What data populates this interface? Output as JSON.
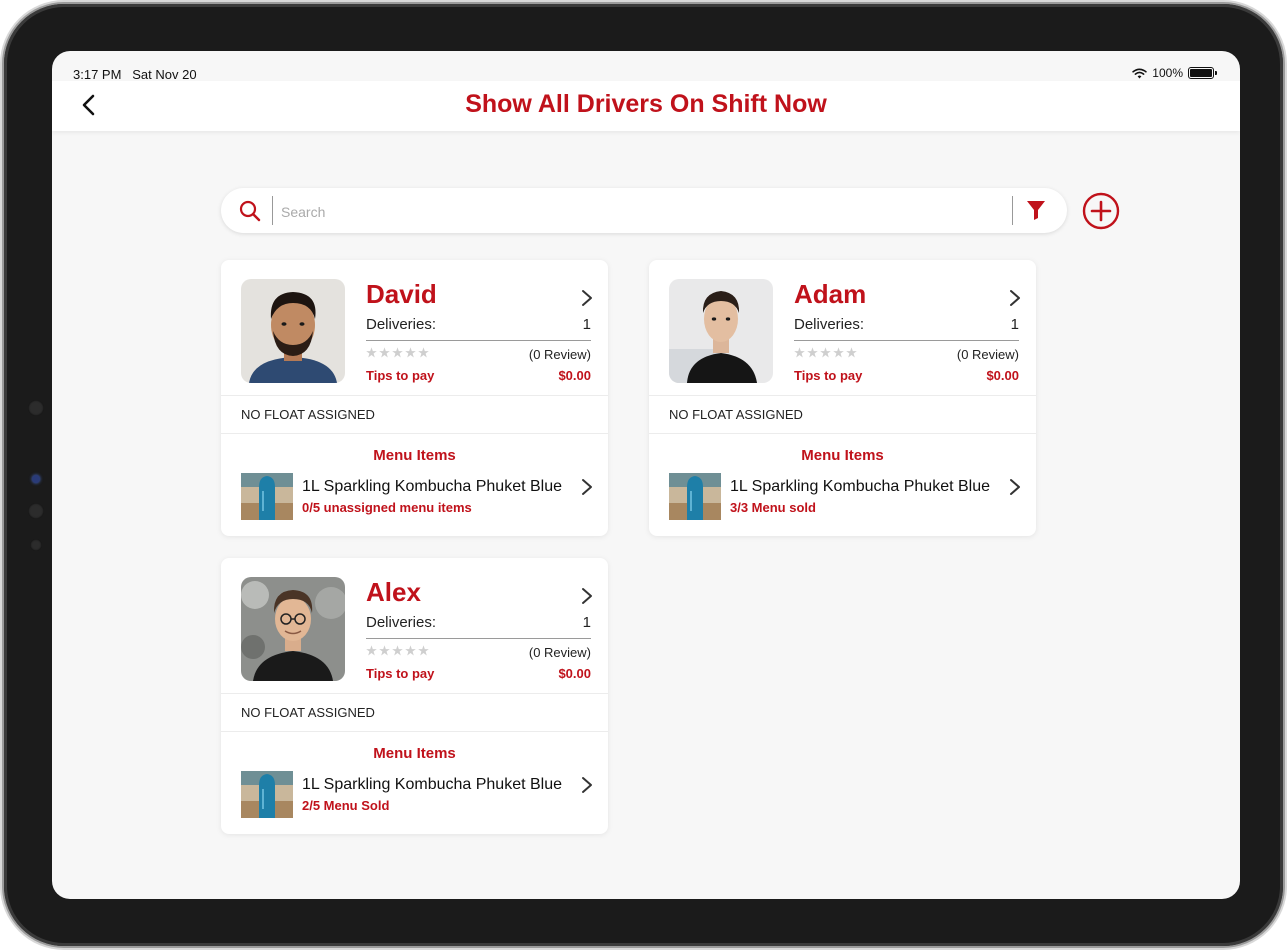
{
  "status_bar": {
    "time": "3:17 PM",
    "date": "Sat Nov 20",
    "battery": "100%",
    "icons": [
      "wifi-icon",
      "battery-icon"
    ]
  },
  "header": {
    "title": "Show All Drivers On Shift Now",
    "back_icon": "chevron-left-icon"
  },
  "search": {
    "placeholder": "Search",
    "value": "",
    "search_icon": "search-icon",
    "filter_icon": "filter-icon"
  },
  "add_icon": "plus-circle-icon",
  "colors": {
    "brand_red": "#c0121b",
    "background": "#f7f7f7"
  },
  "drivers": [
    {
      "name": "David",
      "deliveries_label": "Deliveries:",
      "deliveries": "1",
      "rating": 0,
      "review": "(0 Review)",
      "tips_label": "Tips to pay",
      "tips": "$0.00",
      "float": "NO FLOAT ASSIGNED",
      "menu_title": "Menu Items",
      "item_name": "1L Sparkling Kombucha Phuket Blue",
      "item_status": "0/5 unassigned menu items"
    },
    {
      "name": "Adam",
      "deliveries_label": "Deliveries:",
      "deliveries": "1",
      "rating": 0,
      "review": "(0 Review)",
      "tips_label": "Tips to pay",
      "tips": "$0.00",
      "float": "NO FLOAT ASSIGNED",
      "menu_title": "Menu Items",
      "item_name": "1L Sparkling Kombucha Phuket Blue",
      "item_status": "3/3 Menu sold"
    },
    {
      "name": "Alex",
      "deliveries_label": "Deliveries:",
      "deliveries": "1",
      "rating": 0,
      "review": "(0 Review)",
      "tips_label": "Tips to pay",
      "tips": "$0.00",
      "float": "NO FLOAT ASSIGNED",
      "menu_title": "Menu Items",
      "item_name": "1L Sparkling Kombucha Phuket Blue",
      "item_status": "2/5 Menu Sold"
    }
  ]
}
